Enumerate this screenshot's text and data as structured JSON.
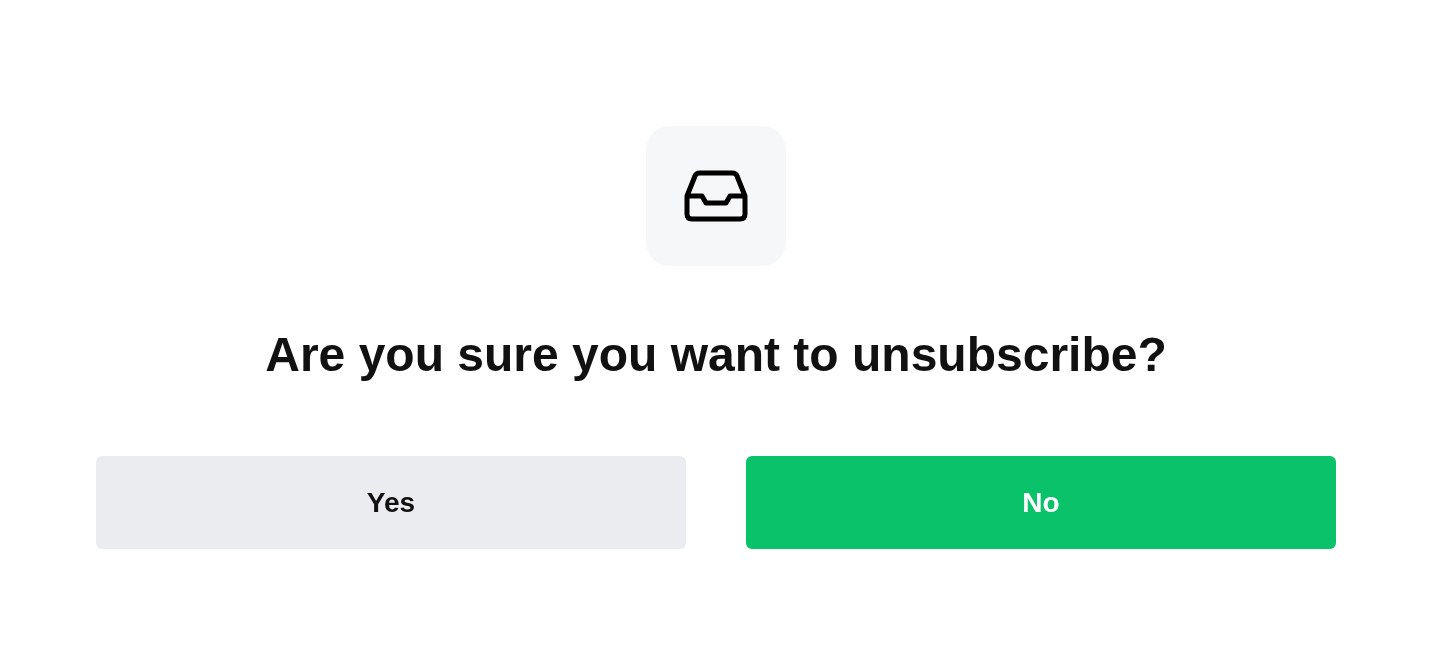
{
  "heading": "Are you sure you want to unsubscribe?",
  "buttons": [
    {
      "label": "Yes",
      "kind": "secondary"
    },
    {
      "label": "No",
      "kind": "primary"
    }
  ]
}
